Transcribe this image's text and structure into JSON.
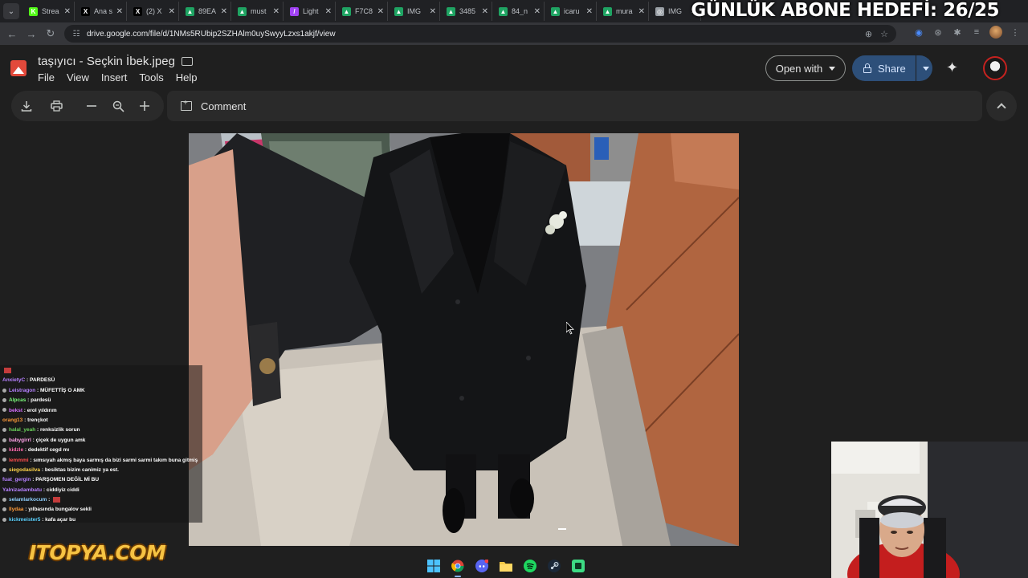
{
  "browser": {
    "tabs": [
      {
        "label": "Strea",
        "favicon": "kick-icon",
        "color": "#53fc18",
        "glyph": "K"
      },
      {
        "label": "Ana s",
        "favicon": "x-icon",
        "color": "#000000",
        "glyph": "X"
      },
      {
        "label": "(2) X",
        "favicon": "x-icon",
        "color": "#000000",
        "glyph": "X"
      },
      {
        "label": "89EA",
        "favicon": "drive-icon",
        "color": "#1fa463",
        "glyph": "▲"
      },
      {
        "label": "must",
        "favicon": "drive-icon",
        "color": "#1fa463",
        "glyph": "▲"
      },
      {
        "label": "Light",
        "favicon": "lightshot-icon",
        "color": "#a142f4",
        "glyph": "/"
      },
      {
        "label": "F7C8",
        "favicon": "drive-icon",
        "color": "#1fa463",
        "glyph": "▲"
      },
      {
        "label": "IMG",
        "favicon": "drive-icon",
        "color": "#1fa463",
        "glyph": "▲"
      },
      {
        "label": "3485",
        "favicon": "drive-icon",
        "color": "#1fa463",
        "glyph": "▲"
      },
      {
        "label": "84_n",
        "favicon": "drive-icon",
        "color": "#1fa463",
        "glyph": "▲"
      },
      {
        "label": "icaru",
        "favicon": "drive-icon",
        "color": "#1fa463",
        "glyph": "▲"
      },
      {
        "label": "mura",
        "favicon": "drive-icon",
        "color": "#1fa463",
        "glyph": "▲"
      },
      {
        "label": "IMG",
        "favicon": "globe-icon",
        "color": "#9aa0a6",
        "glyph": "◎"
      }
    ],
    "url": "drive.google.com/file/d/1NMs5RUbip2SZHAlm0uySwyyLzxs1akjf/view"
  },
  "overlay": {
    "goal_text": "GÜNLÜK ABONE HEDEFİ: 26/25",
    "logo_text": "ITOPYA.COM"
  },
  "viewer": {
    "file_title": "taşıyıcı - Seçkin İbek.jpeg",
    "menus": [
      "File",
      "View",
      "Insert",
      "Tools",
      "Help"
    ],
    "open_with_label": "Open with",
    "share_label": "Share",
    "comment_label": "Comment",
    "colors": {
      "share_bg": "#2d4f79",
      "file_icon": "#e2493b"
    }
  },
  "chat": [
    {
      "user": "",
      "msg": "",
      "color": "#9ea7ff",
      "badge": false,
      "emote": true
    },
    {
      "user": "AnxietyC",
      "msg": "PARDESÜ",
      "color": "#b681ff",
      "badge": false,
      "emote": false
    },
    {
      "user": "Leistragon",
      "msg": "MÜFETTİŞ O AMK",
      "color": "#b681ff",
      "badge": true,
      "emote": false
    },
    {
      "user": "Alpcas",
      "msg": "pardesü",
      "color": "#7cfc7c",
      "badge": true,
      "emote": false
    },
    {
      "user": "bekst",
      "msg": "erol yıldırım",
      "color": "#d66eff",
      "badge": true,
      "emote": false
    },
    {
      "user": "orang13",
      "msg": "trençkot",
      "color": "#ff9b3a",
      "badge": false,
      "emote": false
    },
    {
      "user": "halal_yeah",
      "msg": "renksizlik sorun",
      "color": "#6bd35b",
      "badge": true,
      "emote": false
    },
    {
      "user": "babygirrl",
      "msg": "çiçek de uygun amk",
      "color": "#ffa3e8",
      "badge": true,
      "emote": false
    },
    {
      "user": "kidzle",
      "msg": "dedektif cegd mı",
      "color": "#ff6ab0",
      "badge": true,
      "emote": false
    },
    {
      "user": "lemmmi",
      "msg": "sımsıyah akmış baya sarmış da bizi sarmi sarmi takım buna gitmiş",
      "color": "#ff4d4d",
      "badge": true,
      "emote": false
    },
    {
      "user": "siegodasilva",
      "msg": "besiktas bizim canimiz ya est.",
      "color": "#ffd54a",
      "badge": true,
      "emote": false
    },
    {
      "user": "fuat_gergin",
      "msg": "PARŞOMEN DEĞİL Mİ BU",
      "color": "#b681ff",
      "badge": false,
      "emote": false
    },
    {
      "user": "Yalnizadambatu",
      "msg": "ciddiyiz ciddi",
      "color": "#b681ff",
      "badge": false,
      "emote": false
    },
    {
      "user": "selamlarkocum",
      "msg": "",
      "color": "#8fd0ff",
      "badge": true,
      "emote": true
    },
    {
      "user": "llydaa",
      "msg": "yılbasında bungalov sekli",
      "color": "#ff9b3a",
      "badge": true,
      "emote": false
    },
    {
      "user": "kickmeister5",
      "msg": "kafa açar bu",
      "color": "#5ad2ff",
      "badge": true,
      "emote": false
    }
  ]
}
